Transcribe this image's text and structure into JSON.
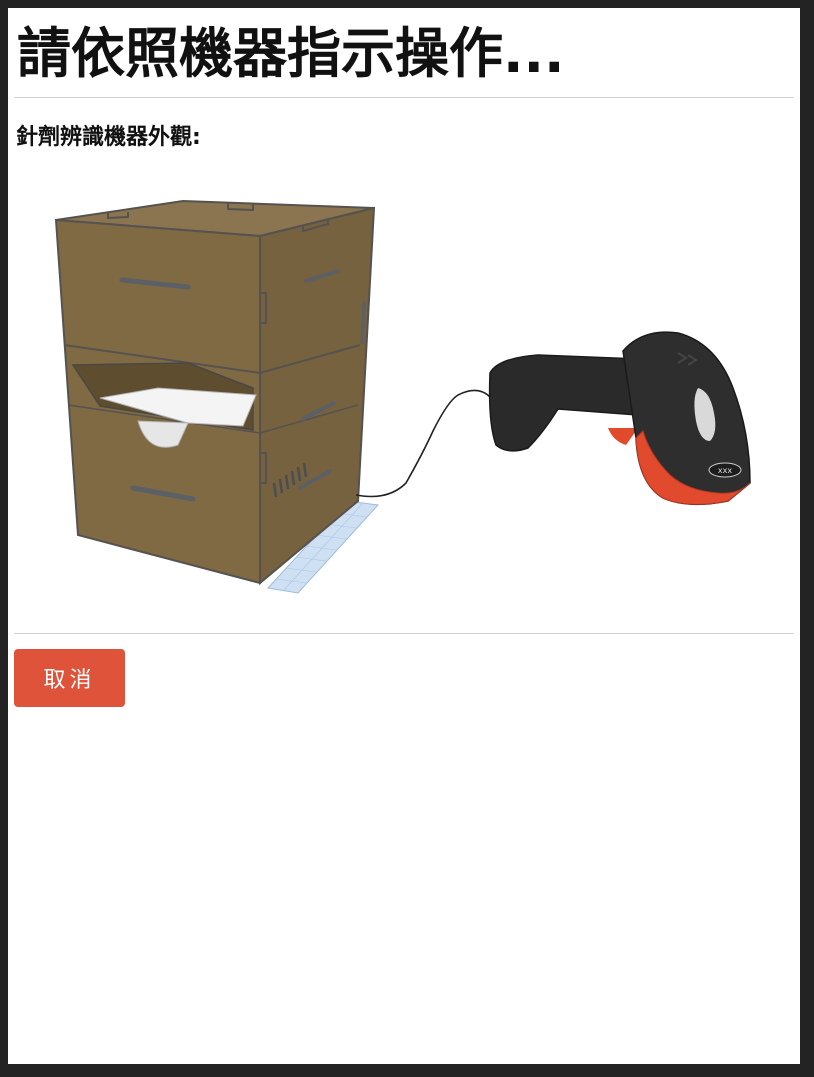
{
  "header": {
    "title": "請依照機器指示操作..."
  },
  "main": {
    "section_label": "針劑辨識機器外觀:",
    "illustration": {
      "icons": [
        "machine-box-icon",
        "barcode-scanner-icon"
      ],
      "scanner_brand": "xxx"
    }
  },
  "actions": {
    "cancel_label": "取消"
  },
  "colors": {
    "page_background": "#ffffff",
    "frame_background": "#232323",
    "cancel_button": "#de5339",
    "box_wood": "#7d6842",
    "scanner_accent": "#e24a2e"
  }
}
